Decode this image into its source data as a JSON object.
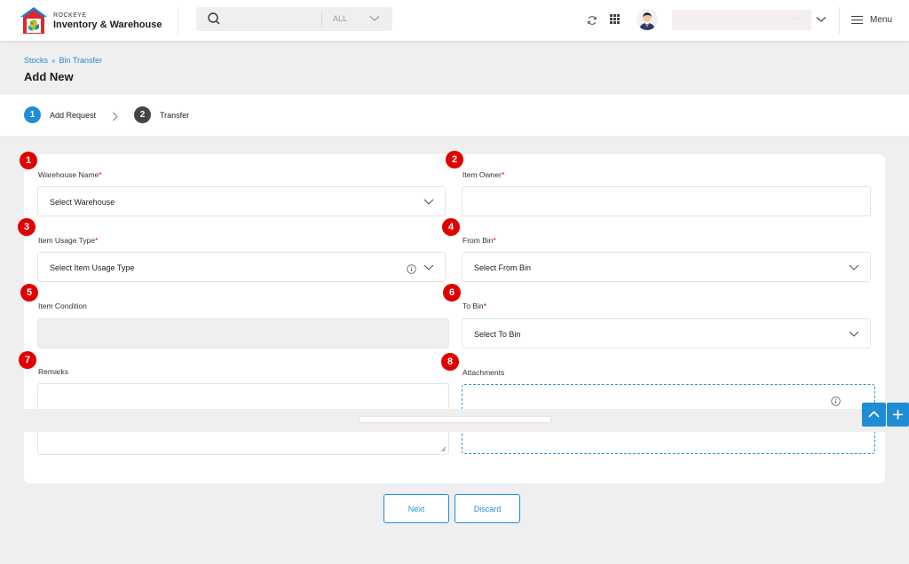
{
  "header": {
    "brand_small": "ROCKEYE",
    "brand_main": "Inventory & Warehouse",
    "search": {
      "value": "",
      "scope": "ALL"
    },
    "user_name": "••••••",
    "menu_label": "Menu",
    "icons": [
      "logo-icon",
      "search-icon",
      "chevron-down-icon",
      "refresh-icon",
      "apps-grid-icon",
      "avatar",
      "hamburger-icon"
    ]
  },
  "breadcrumb": {
    "root": "Stocks",
    "current": "Bin Transfer"
  },
  "page_title": "Add New",
  "stepper": [
    {
      "num": "1",
      "label": "Add Request",
      "color": "#1f8dd6"
    },
    {
      "num": "2",
      "label": "Transfer",
      "color": "#444444"
    }
  ],
  "form": {
    "badges": [
      "1",
      "2",
      "3",
      "4",
      "5",
      "6",
      "7",
      "8"
    ],
    "warehouse": {
      "label": "Warehouse Name",
      "req": "*",
      "placeholder": "Select Warehouse"
    },
    "owner": {
      "label": "Item Owner",
      "req": "*",
      "value": ""
    },
    "usage": {
      "label": "Item Usage Type",
      "req": "*",
      "placeholder": "Select Item Usage Type"
    },
    "from_bin": {
      "label": "From Bin",
      "req": "*",
      "placeholder": "Select From Bin"
    },
    "condition": {
      "label": "Item Condition",
      "value": ""
    },
    "to_bin": {
      "label": "To Bin",
      "req": "*",
      "placeholder": "Select To Bin"
    },
    "remarks": {
      "label": "Remarks",
      "value": ""
    },
    "attachments": {
      "label": "Attachments"
    }
  },
  "actions": {
    "next": "Next",
    "discard": "Discard"
  },
  "colors": {
    "accent": "#1f8dd6",
    "required": "#e10000",
    "badge": "#e10000"
  }
}
